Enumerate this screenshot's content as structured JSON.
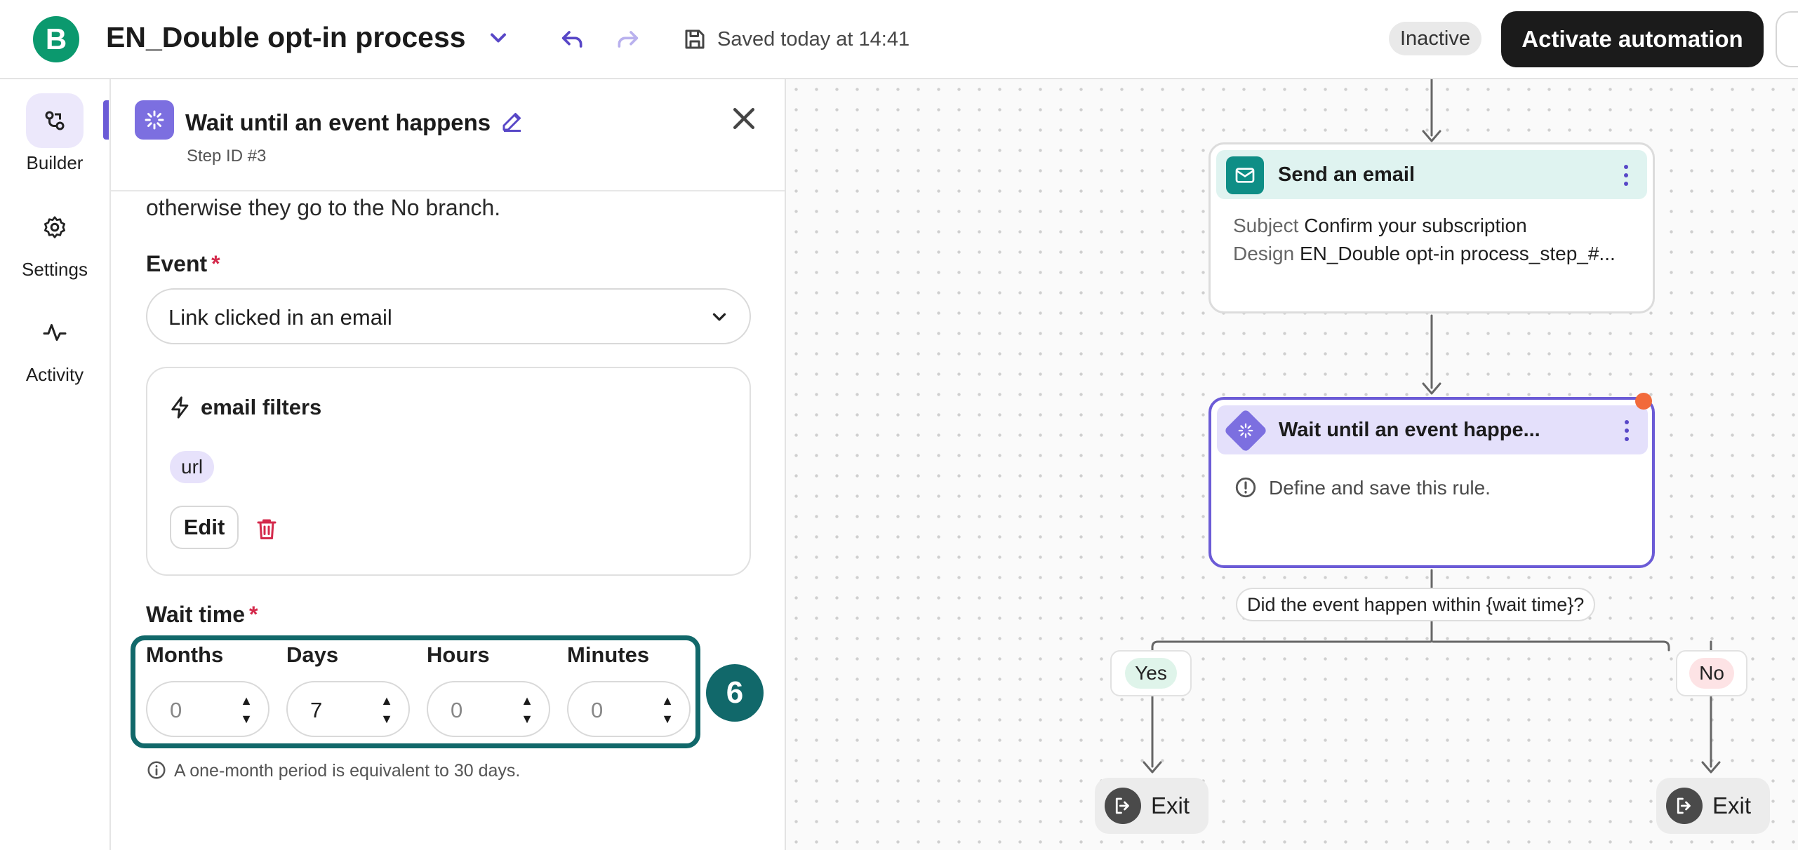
{
  "app": {
    "logo_letter": "B",
    "workflow_title": "EN_Double opt-in process",
    "saved_status": "Saved today at 14:41",
    "status_badge": "Inactive",
    "activate_label": "Activate automation",
    "brand_color": "#0b996e",
    "accent_color": "#6b5bd6"
  },
  "nav": {
    "items": [
      {
        "label": "Builder",
        "icon": "builder-icon",
        "active": true
      },
      {
        "label": "Settings",
        "icon": "gear-icon",
        "active": false
      },
      {
        "label": "Activity",
        "icon": "activity-icon",
        "active": false
      }
    ]
  },
  "panel": {
    "title": "Wait until an event happens",
    "step_id": "Step ID #3",
    "intro_tail": "otherwise they go to the No branch.",
    "event_label": "Event",
    "required_mark": "*",
    "event_value": "Link clicked in an email",
    "filters_title": "email filters",
    "filter_chip": "url",
    "edit_label": "Edit",
    "wait_label": "Wait time",
    "wait_fields": [
      {
        "label": "Months",
        "value": "0"
      },
      {
        "label": "Days",
        "value": "7"
      },
      {
        "label": "Hours",
        "value": "0"
      },
      {
        "label": "Minutes",
        "value": "0"
      }
    ],
    "callout_number": "6",
    "note": "A one-month period is equivalent to 30 days."
  },
  "canvas": {
    "email_node": {
      "title": "Send an email",
      "subject_key": "Subject",
      "subject_value": "Confirm your subscription",
      "design_key": "Design",
      "design_value": "EN_Double opt-in process_step_#..."
    },
    "wait_node": {
      "title": "Wait until an event happe...",
      "warning": "Define and save this rule."
    },
    "question": "Did the event happen within {wait time}?",
    "yes_label": "Yes",
    "no_label": "No",
    "exit_label": "Exit"
  }
}
